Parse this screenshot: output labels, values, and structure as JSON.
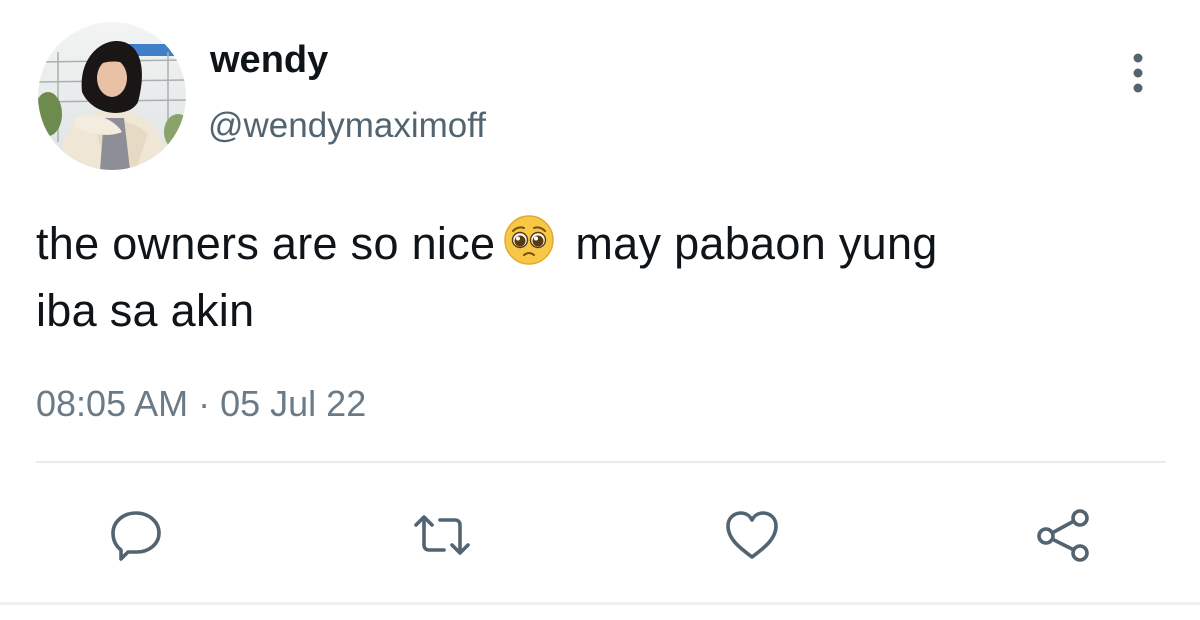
{
  "tweet": {
    "display_name": "wendy",
    "handle": "@wendymaximoff",
    "text_line1_before_emoji": "the owners are so nice",
    "emoji": "pleading-face",
    "text_line1_after_emoji": "may pabaon yung",
    "text_line2": "iba sa akin",
    "time": "08:05 AM",
    "separator": "·",
    "date": "05 Jul 22"
  },
  "actions": {
    "items": [
      "reply",
      "retweet",
      "like",
      "share"
    ]
  },
  "colors": {
    "text_primary": "#0f1419",
    "text_secondary": "#536471",
    "icon": "#536471",
    "divider": "#e7ebee",
    "emoji_face": "#f7c846"
  },
  "icons": {
    "more": "more-vertical-icon",
    "reply": "reply-bubble-icon",
    "retweet": "retweet-icon",
    "like": "heart-icon",
    "share": "share-nodes-icon"
  }
}
